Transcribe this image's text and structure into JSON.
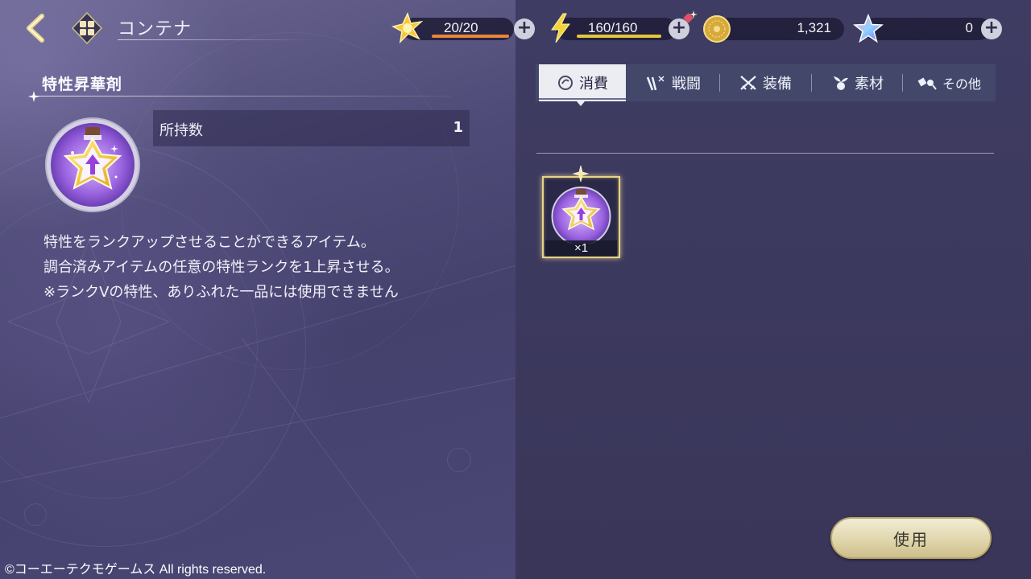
{
  "header": {
    "title": "コンテナ",
    "resources": [
      {
        "id": "stamina",
        "value": "20/20",
        "fill": 1.0,
        "bar_color": "#e8863a",
        "icon": "star-burst-icon"
      },
      {
        "id": "energy",
        "value": "160/160",
        "fill": 1.0,
        "bar_color": "#e2c63b",
        "icon": "lightning-icon"
      },
      {
        "id": "coins",
        "value": "1,321",
        "icon": "gold-coin-icon"
      },
      {
        "id": "gems",
        "value": "0",
        "icon": "rainbow-star-icon"
      }
    ]
  },
  "detail": {
    "item_name": "特性昇華剤",
    "owned_label": "所持数",
    "owned_value": "1",
    "description": [
      "特性をランクアップさせることができるアイテム。",
      "調合済みアイテムの任意の特性ランクを1上昇させる。",
      "※ランクVの特性、ありふれた一品には使用できません"
    ]
  },
  "tabs": [
    {
      "label": "消費",
      "icon": "consumable-icon",
      "active": true
    },
    {
      "label": "戦闘",
      "icon": "battle-icon",
      "active": false
    },
    {
      "label": "装備",
      "icon": "equipment-icon",
      "active": false
    },
    {
      "label": "素材",
      "icon": "material-icon",
      "active": false
    },
    {
      "label": "その他",
      "icon": "other-icon",
      "active": false
    }
  ],
  "inventory": [
    {
      "name": "特性昇華剤",
      "count": "×1",
      "selected": true
    }
  ],
  "use_button": "使用",
  "copyright": "©コーエーテクモゲームス All rights reserved.",
  "colors": {
    "accent_gold": "#e8d488",
    "active_tab": "#ecedf3"
  }
}
